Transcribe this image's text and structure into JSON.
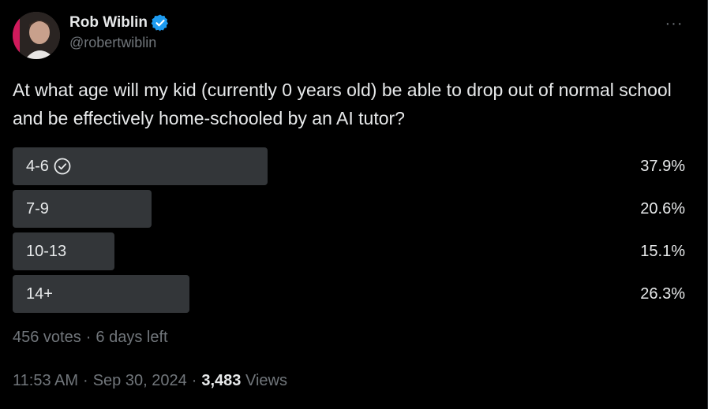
{
  "author": {
    "display_name": "Rob Wiblin",
    "handle": "@robertwiblin",
    "verified": true
  },
  "more_menu": "···",
  "tweet": {
    "text": "At what age will my kid (currently 0 years old) be able to drop out of normal school and be effectively home-schooled by an AI tutor?"
  },
  "poll": {
    "options": [
      {
        "label": "4-6",
        "percent_text": "37.9%",
        "percent": 37.9,
        "winner": true
      },
      {
        "label": "7-9",
        "percent_text": "20.6%",
        "percent": 20.6,
        "winner": false
      },
      {
        "label": "10-13",
        "percent_text": "15.1%",
        "percent": 15.1,
        "winner": false
      },
      {
        "label": "14+",
        "percent_text": "26.3%",
        "percent": 26.3,
        "winner": false
      }
    ],
    "votes": "456 votes",
    "time_left": "6 days left"
  },
  "meta": {
    "time": "11:53 AM",
    "date": "Sep 30, 2024",
    "views_count": "3,483",
    "views_label": "Views"
  },
  "colors": {
    "background": "#000000",
    "text": "#e7e9ea",
    "secondary_text": "#71767b",
    "poll_bar": "#333639",
    "verified_badge": "#1d9bf0"
  }
}
